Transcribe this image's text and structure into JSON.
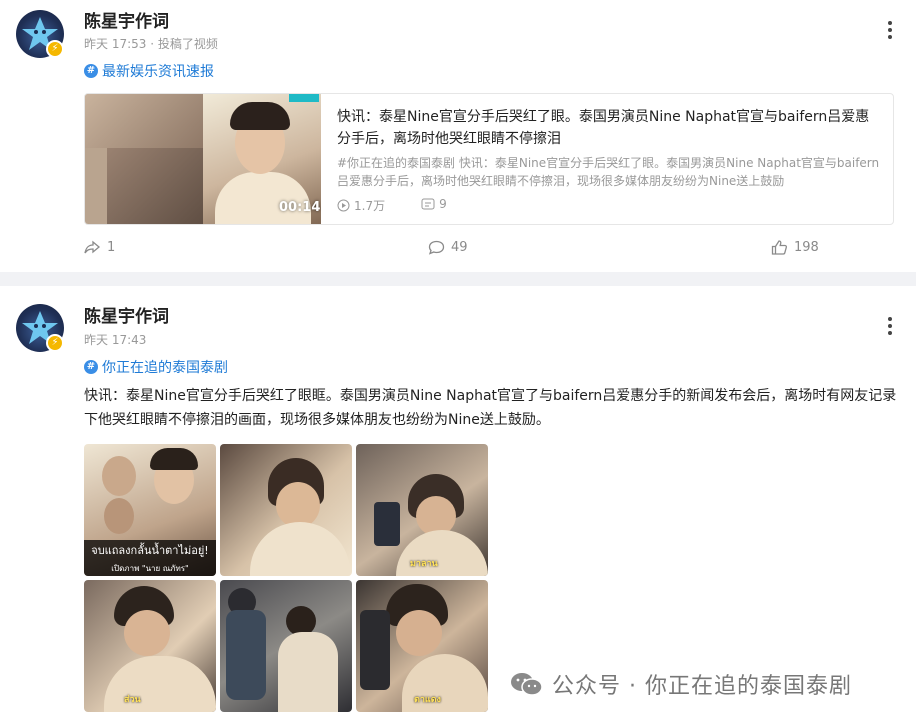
{
  "post1": {
    "username": "陈星宇作词",
    "meta": "昨天 17:53 · 投稿了视频",
    "topic": "最新娱乐资讯速报",
    "video": {
      "duration": "00:14",
      "title": "快讯：泰星Nine官宣分手后哭红了眼。泰国男演员Nine Naphat官宣与baifern吕爱惠分手后，离场时他哭红眼睛不停擦泪",
      "description": "#你正在追的泰国泰剧 快讯：泰星Nine官宣分手后哭红了眼。泰国男演员Nine Naphat官宣与baifern吕爱惠分手后，离场时他哭红眼睛不停擦泪，现场很多媒体朋友纷纷为Nine送上鼓励",
      "plays": "1.7万",
      "comments": "9"
    },
    "actions": {
      "share": "1",
      "comment": "49",
      "like": "198"
    }
  },
  "post2": {
    "username": "陈星宇作词",
    "meta": "昨天 17:43",
    "topic": "你正在追的泰国泰剧",
    "text": "快讯：泰星Nine官宣分手后哭红了眼眶。泰国男演员Nine Naphat官宣了与baifern吕爱惠分手的新闻发布会后，离场时有网友记录下他哭红眼睛不停擦泪的画面，现场很多媒体朋友也纷纷为Nine送上鼓励。",
    "image1_caption": "จบแถลงกลั้นน้ำตาไม่อยู่!",
    "image1_subcaption": "เปิดภาพ \"นาย ณภัทร\""
  },
  "watermark": "公众号 · 你正在追的泰国泰剧",
  "colors": {
    "accent": "#1f7bd6",
    "badge": "#f5b800"
  }
}
